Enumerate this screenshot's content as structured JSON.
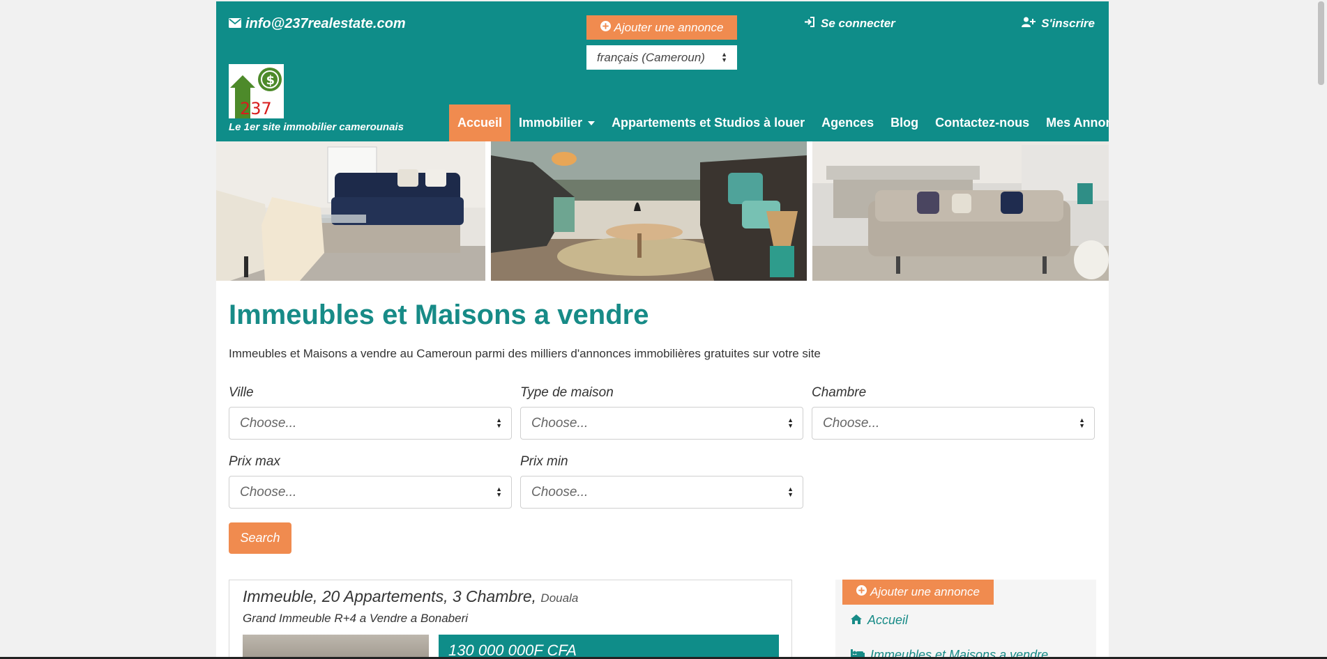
{
  "header": {
    "email": "info@237realestate.com",
    "add_ad_label": "Ajouter une annonce",
    "language_selected": "français (Cameroun)",
    "login_label": "Se connecter",
    "signup_label": "S'inscrire",
    "logo_text": "237",
    "tagline": "Le 1er site immobilier camerounais"
  },
  "nav": {
    "items": [
      {
        "label": "Accueil",
        "active": true
      },
      {
        "label": "Immobilier",
        "has_dropdown": true
      },
      {
        "label": "Appartements et Studios à louer"
      },
      {
        "label": "Agences"
      },
      {
        "label": "Blog"
      },
      {
        "label": "Contactez-nous"
      },
      {
        "label": "Mes Annonces"
      }
    ]
  },
  "main": {
    "title": "Immeubles et Maisons a vendre",
    "description": "Immeubles et Maisons a vendre au Cameroun parmi des milliers d'annonces immobilières gratuites sur votre site"
  },
  "filters": {
    "ville": {
      "label": "Ville",
      "value": "Choose..."
    },
    "type_maison": {
      "label": "Type de maison",
      "value": "Choose..."
    },
    "chambre": {
      "label": "Chambre",
      "value": "Choose..."
    },
    "prix_max": {
      "label": "Prix max",
      "value": "Choose..."
    },
    "prix_min": {
      "label": "Prix min",
      "value": "Choose..."
    },
    "search_label": "Search"
  },
  "listing": {
    "title": "Immeuble, 20 Appartements, 3 Chambre,",
    "city": "Douala",
    "subtitle": "Grand Immeuble R+4 a Vendre a Bonaberi",
    "price": "130 000 000F CFA"
  },
  "sidebar": {
    "add_ad_label": "Ajouter une annonce",
    "links": [
      "Accueil",
      "Immeubles et Maisons a vendre"
    ]
  },
  "colors": {
    "brand_teal": "#0f8d89",
    "accent_orange": "#f08b4f"
  },
  "icons": {
    "email": "envelope-icon",
    "add": "plus-circle-icon",
    "login": "sign-in-icon",
    "signup": "user-plus-icon",
    "home": "home-icon",
    "bed": "bed-icon"
  }
}
